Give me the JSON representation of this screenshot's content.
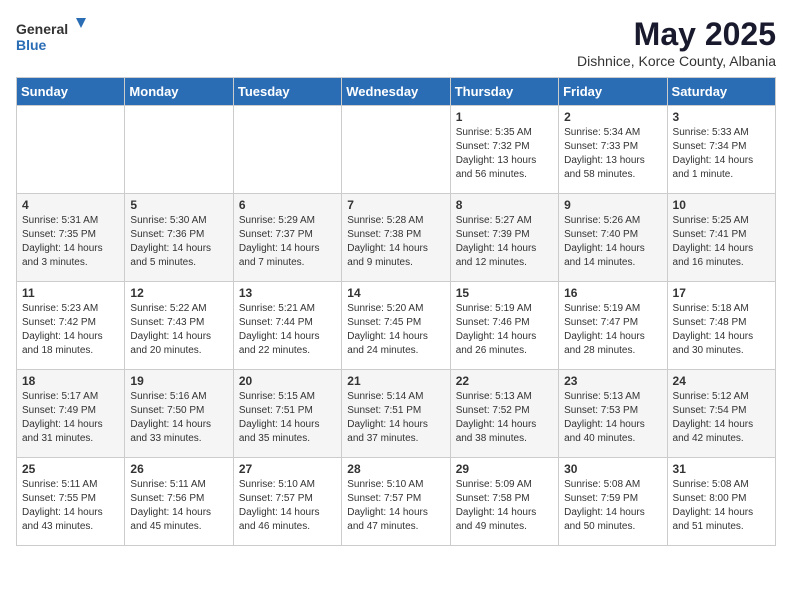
{
  "logo": {
    "general": "General",
    "blue": "Blue"
  },
  "title": "May 2025",
  "location": "Dishnice, Korce County, Albania",
  "days_of_week": [
    "Sunday",
    "Monday",
    "Tuesday",
    "Wednesday",
    "Thursday",
    "Friday",
    "Saturday"
  ],
  "weeks": [
    [
      {
        "day": "",
        "info": ""
      },
      {
        "day": "",
        "info": ""
      },
      {
        "day": "",
        "info": ""
      },
      {
        "day": "",
        "info": ""
      },
      {
        "day": "1",
        "sunrise": "Sunrise: 5:35 AM",
        "sunset": "Sunset: 7:32 PM",
        "daylight": "Daylight: 13 hours and 56 minutes."
      },
      {
        "day": "2",
        "sunrise": "Sunrise: 5:34 AM",
        "sunset": "Sunset: 7:33 PM",
        "daylight": "Daylight: 13 hours and 58 minutes."
      },
      {
        "day": "3",
        "sunrise": "Sunrise: 5:33 AM",
        "sunset": "Sunset: 7:34 PM",
        "daylight": "Daylight: 14 hours and 1 minute."
      }
    ],
    [
      {
        "day": "4",
        "sunrise": "Sunrise: 5:31 AM",
        "sunset": "Sunset: 7:35 PM",
        "daylight": "Daylight: 14 hours and 3 minutes."
      },
      {
        "day": "5",
        "sunrise": "Sunrise: 5:30 AM",
        "sunset": "Sunset: 7:36 PM",
        "daylight": "Daylight: 14 hours and 5 minutes."
      },
      {
        "day": "6",
        "sunrise": "Sunrise: 5:29 AM",
        "sunset": "Sunset: 7:37 PM",
        "daylight": "Daylight: 14 hours and 7 minutes."
      },
      {
        "day": "7",
        "sunrise": "Sunrise: 5:28 AM",
        "sunset": "Sunset: 7:38 PM",
        "daylight": "Daylight: 14 hours and 9 minutes."
      },
      {
        "day": "8",
        "sunrise": "Sunrise: 5:27 AM",
        "sunset": "Sunset: 7:39 PM",
        "daylight": "Daylight: 14 hours and 12 minutes."
      },
      {
        "day": "9",
        "sunrise": "Sunrise: 5:26 AM",
        "sunset": "Sunset: 7:40 PM",
        "daylight": "Daylight: 14 hours and 14 minutes."
      },
      {
        "day": "10",
        "sunrise": "Sunrise: 5:25 AM",
        "sunset": "Sunset: 7:41 PM",
        "daylight": "Daylight: 14 hours and 16 minutes."
      }
    ],
    [
      {
        "day": "11",
        "sunrise": "Sunrise: 5:23 AM",
        "sunset": "Sunset: 7:42 PM",
        "daylight": "Daylight: 14 hours and 18 minutes."
      },
      {
        "day": "12",
        "sunrise": "Sunrise: 5:22 AM",
        "sunset": "Sunset: 7:43 PM",
        "daylight": "Daylight: 14 hours and 20 minutes."
      },
      {
        "day": "13",
        "sunrise": "Sunrise: 5:21 AM",
        "sunset": "Sunset: 7:44 PM",
        "daylight": "Daylight: 14 hours and 22 minutes."
      },
      {
        "day": "14",
        "sunrise": "Sunrise: 5:20 AM",
        "sunset": "Sunset: 7:45 PM",
        "daylight": "Daylight: 14 hours and 24 minutes."
      },
      {
        "day": "15",
        "sunrise": "Sunrise: 5:19 AM",
        "sunset": "Sunset: 7:46 PM",
        "daylight": "Daylight: 14 hours and 26 minutes."
      },
      {
        "day": "16",
        "sunrise": "Sunrise: 5:19 AM",
        "sunset": "Sunset: 7:47 PM",
        "daylight": "Daylight: 14 hours and 28 minutes."
      },
      {
        "day": "17",
        "sunrise": "Sunrise: 5:18 AM",
        "sunset": "Sunset: 7:48 PM",
        "daylight": "Daylight: 14 hours and 30 minutes."
      }
    ],
    [
      {
        "day": "18",
        "sunrise": "Sunrise: 5:17 AM",
        "sunset": "Sunset: 7:49 PM",
        "daylight": "Daylight: 14 hours and 31 minutes."
      },
      {
        "day": "19",
        "sunrise": "Sunrise: 5:16 AM",
        "sunset": "Sunset: 7:50 PM",
        "daylight": "Daylight: 14 hours and 33 minutes."
      },
      {
        "day": "20",
        "sunrise": "Sunrise: 5:15 AM",
        "sunset": "Sunset: 7:51 PM",
        "daylight": "Daylight: 14 hours and 35 minutes."
      },
      {
        "day": "21",
        "sunrise": "Sunrise: 5:14 AM",
        "sunset": "Sunset: 7:51 PM",
        "daylight": "Daylight: 14 hours and 37 minutes."
      },
      {
        "day": "22",
        "sunrise": "Sunrise: 5:13 AM",
        "sunset": "Sunset: 7:52 PM",
        "daylight": "Daylight: 14 hours and 38 minutes."
      },
      {
        "day": "23",
        "sunrise": "Sunrise: 5:13 AM",
        "sunset": "Sunset: 7:53 PM",
        "daylight": "Daylight: 14 hours and 40 minutes."
      },
      {
        "day": "24",
        "sunrise": "Sunrise: 5:12 AM",
        "sunset": "Sunset: 7:54 PM",
        "daylight": "Daylight: 14 hours and 42 minutes."
      }
    ],
    [
      {
        "day": "25",
        "sunrise": "Sunrise: 5:11 AM",
        "sunset": "Sunset: 7:55 PM",
        "daylight": "Daylight: 14 hours and 43 minutes."
      },
      {
        "day": "26",
        "sunrise": "Sunrise: 5:11 AM",
        "sunset": "Sunset: 7:56 PM",
        "daylight": "Daylight: 14 hours and 45 minutes."
      },
      {
        "day": "27",
        "sunrise": "Sunrise: 5:10 AM",
        "sunset": "Sunset: 7:57 PM",
        "daylight": "Daylight: 14 hours and 46 minutes."
      },
      {
        "day": "28",
        "sunrise": "Sunrise: 5:10 AM",
        "sunset": "Sunset: 7:57 PM",
        "daylight": "Daylight: 14 hours and 47 minutes."
      },
      {
        "day": "29",
        "sunrise": "Sunrise: 5:09 AM",
        "sunset": "Sunset: 7:58 PM",
        "daylight": "Daylight: 14 hours and 49 minutes."
      },
      {
        "day": "30",
        "sunrise": "Sunrise: 5:08 AM",
        "sunset": "Sunset: 7:59 PM",
        "daylight": "Daylight: 14 hours and 50 minutes."
      },
      {
        "day": "31",
        "sunrise": "Sunrise: 5:08 AM",
        "sunset": "Sunset: 8:00 PM",
        "daylight": "Daylight: 14 hours and 51 minutes."
      }
    ]
  ]
}
